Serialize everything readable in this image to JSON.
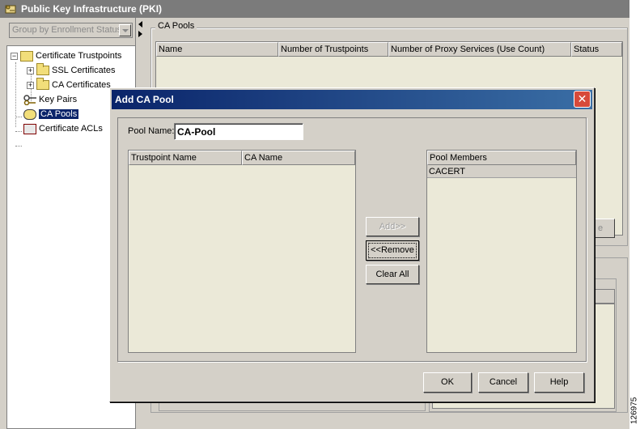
{
  "app": {
    "title": "Public Key Infrastructure (PKI)"
  },
  "sidebar": {
    "group_select": "Group by Enrollment Status",
    "tree": [
      {
        "label": "Certificate Trustpoints",
        "expander": "−"
      },
      {
        "label": "SSL Certificates",
        "expander": "+"
      },
      {
        "label": "CA Certificates",
        "expander": "+"
      },
      {
        "label": "Key Pairs"
      },
      {
        "label": "CA Pools",
        "selected": true
      },
      {
        "label": "Certificate ACLs"
      }
    ]
  },
  "main": {
    "group_title": "CA Pools",
    "columns": [
      "Name",
      "Number of Trustpoints",
      "Number of Proxy Services (Use Count)",
      "Status"
    ],
    "partial_button_text": "e"
  },
  "dialog": {
    "title": "Add CA Pool",
    "close_glyph": "✕",
    "pool_name_label": "Pool Name:",
    "pool_name_value": "CA-Pool",
    "left_columns": [
      "Trustpoint Name",
      "CA Name"
    ],
    "right_column": "Pool Members",
    "pool_members": [
      "CACERT"
    ],
    "add_button": "Add>>",
    "remove_button": "<<Remove",
    "clear_button": "Clear All",
    "ok_button": "OK",
    "cancel_button": "Cancel",
    "help_button": "Help"
  },
  "figure_id": "126975",
  "colors": {
    "selection": "#0a246a",
    "title_gradient_start": "#0a246a",
    "table_background": "#ebe9d8",
    "close_button": "#d74a3a"
  }
}
